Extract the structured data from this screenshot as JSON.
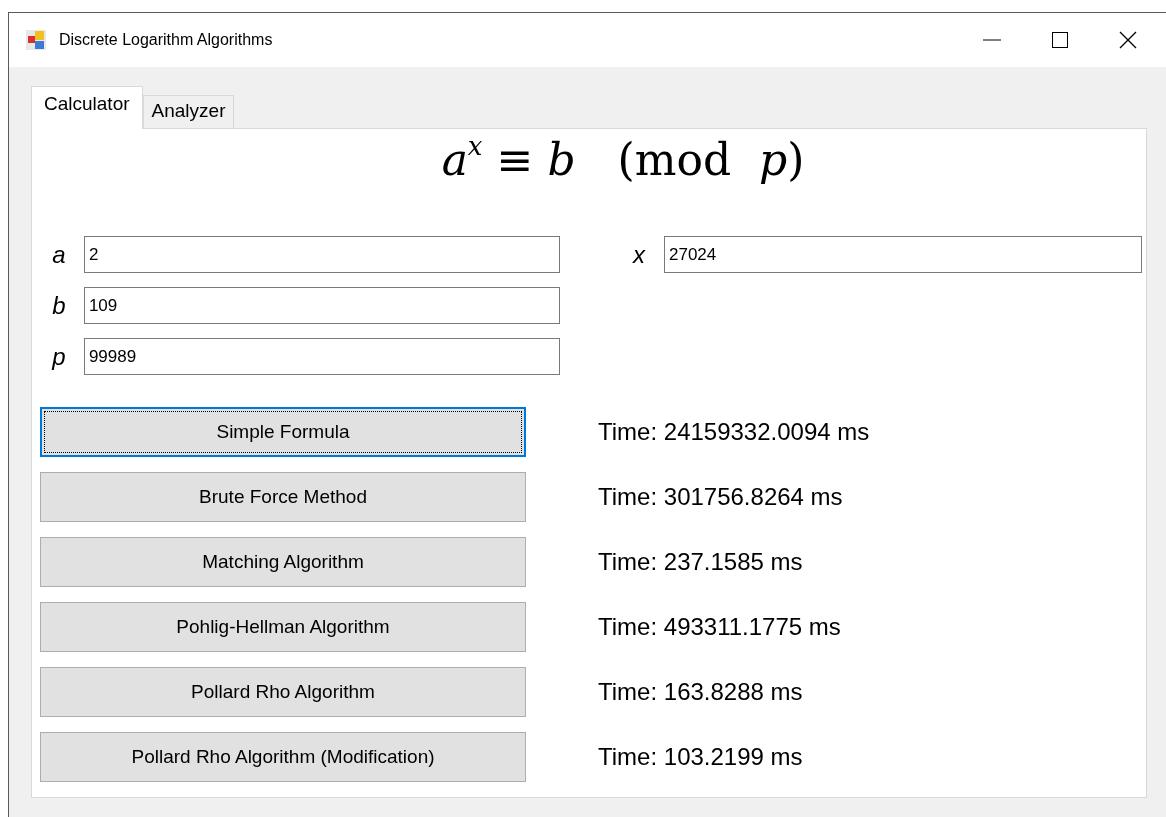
{
  "window": {
    "title": "Discrete Logarithm Algorithms"
  },
  "tabs": [
    {
      "label": "Calculator",
      "selected": true
    },
    {
      "label": "Analyzer",
      "selected": false
    }
  ],
  "formula": "*a*$^{x}$ ≡ *b*   (mod  *p*)",
  "inputs": [
    {
      "label": "a",
      "value": "2"
    },
    {
      "label": "b",
      "value": "109"
    },
    {
      "label": "p",
      "value": "99989"
    }
  ],
  "output": {
    "label": "x",
    "value": "27024"
  },
  "methods": [
    {
      "button": "Simple Formula",
      "focused": true,
      "time": "Time: 24159332.0094 ms"
    },
    {
      "button": "Brute Force Method",
      "focused": false,
      "time": "Time: 301756.8264 ms"
    },
    {
      "button": "Matching Algorithm",
      "focused": false,
      "time": "Time: 237.1585 ms"
    },
    {
      "button": "Pohlig-Hellman Algorithm",
      "focused": false,
      "time": "Time: 493311.1775 ms"
    },
    {
      "button": "Pollard Rho Algorithm",
      "focused": false,
      "time": "Time: 163.8288 ms"
    },
    {
      "button": "Pollard Rho Algorithm (Modification)",
      "focused": false,
      "time": "Time: 103.2199 ms"
    }
  ]
}
